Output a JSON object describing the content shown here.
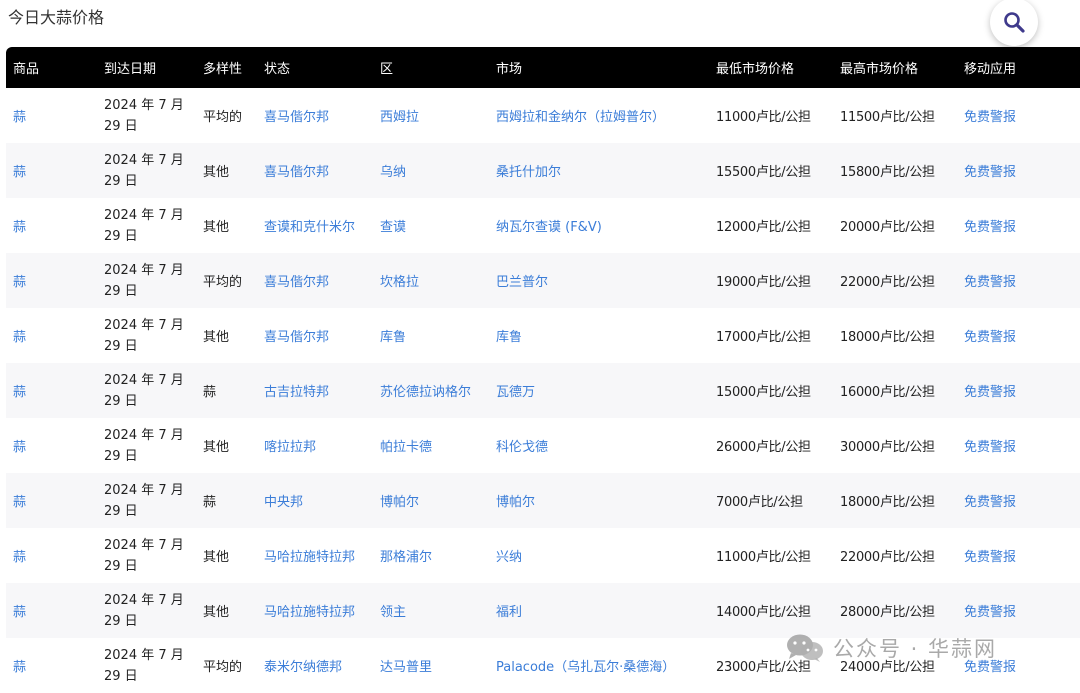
{
  "page": {
    "title": "今日大蒜价格"
  },
  "table": {
    "headers": [
      "商品",
      "到达日期",
      "多样性",
      "状态",
      "区",
      "市场",
      "最低市场价格",
      "最高市场价格",
      "移动应用"
    ],
    "rows": [
      {
        "commodity": "蒜",
        "date_line1": "2024 年 7 月",
        "date_line2": "29 日",
        "variety": "平均的",
        "state": "喜马偕尔邦",
        "district": "西姆拉",
        "market": "西姆拉和金纳尔（拉姆普尔）",
        "min_price": "11000卢比/公担",
        "max_price": "11500卢比/公担",
        "app": "免费警报"
      },
      {
        "commodity": "蒜",
        "date_line1": "2024 年 7 月",
        "date_line2": "29 日",
        "variety": "其他",
        "state": "喜马偕尔邦",
        "district": "乌纳",
        "market": "桑托什加尔",
        "min_price": "15500卢比/公担",
        "max_price": "15800卢比/公担",
        "app": "免费警报"
      },
      {
        "commodity": "蒜",
        "date_line1": "2024 年 7 月",
        "date_line2": "29 日",
        "variety": "其他",
        "state": "查谟和克什米尔",
        "district": "查谟",
        "market": "纳瓦尔查谟 (F&V)",
        "min_price": "12000卢比/公担",
        "max_price": "20000卢比/公担",
        "app": "免费警报"
      },
      {
        "commodity": "蒜",
        "date_line1": "2024 年 7 月",
        "date_line2": "29 日",
        "variety": "平均的",
        "state": "喜马偕尔邦",
        "district": "坎格拉",
        "market": "巴兰普尔",
        "min_price": "19000卢比/公担",
        "max_price": "22000卢比/公担",
        "app": "免费警报"
      },
      {
        "commodity": "蒜",
        "date_line1": "2024 年 7 月",
        "date_line2": "29 日",
        "variety": "其他",
        "state": "喜马偕尔邦",
        "district": "库鲁",
        "market": "库鲁",
        "min_price": "17000卢比/公担",
        "max_price": "18000卢比/公担",
        "app": "免费警报"
      },
      {
        "commodity": "蒜",
        "date_line1": "2024 年 7 月",
        "date_line2": "29 日",
        "variety": "蒜",
        "state": "古吉拉特邦",
        "district": "苏伦德拉讷格尔",
        "market": "瓦德万",
        "min_price": "15000卢比/公担",
        "max_price": "16000卢比/公担",
        "app": "免费警报"
      },
      {
        "commodity": "蒜",
        "date_line1": "2024 年 7 月",
        "date_line2": "29 日",
        "variety": "其他",
        "state": "喀拉拉邦",
        "district": "帕拉卡德",
        "market": "科伦戈德",
        "min_price": "26000卢比/公担",
        "max_price": "30000卢比/公担",
        "app": "免费警报"
      },
      {
        "commodity": "蒜",
        "date_line1": "2024 年 7 月",
        "date_line2": "29 日",
        "variety": "蒜",
        "state": "中央邦",
        "district": "博帕尔",
        "market": "博帕尔",
        "min_price": "7000卢比/公担",
        "max_price": "18000卢比/公担",
        "app": "免费警报"
      },
      {
        "commodity": "蒜",
        "date_line1": "2024 年 7 月",
        "date_line2": "29 日",
        "variety": "其他",
        "state": "马哈拉施特拉邦",
        "district": "那格浦尔",
        "market": "兴纳",
        "min_price": "11000卢比/公担",
        "max_price": "22000卢比/公担",
        "app": "免费警报"
      },
      {
        "commodity": "蒜",
        "date_line1": "2024 年 7 月",
        "date_line2": "29 日",
        "variety": "其他",
        "state": "马哈拉施特拉邦",
        "district": "领主",
        "market": "福利",
        "min_price": "14000卢比/公担",
        "max_price": "28000卢比/公担",
        "app": "免费警报"
      },
      {
        "commodity": "蒜",
        "date_line1": "2024 年 7 月",
        "date_line2": "29 日",
        "variety": "平均的",
        "state": "泰米尔纳德邦",
        "district": "达马普里",
        "market": "Palacode（乌扎瓦尔·桑德海）",
        "min_price": "23000卢比/公担",
        "max_price": "24000卢比/公担",
        "app": "免费警报"
      }
    ]
  },
  "watermark": {
    "text": "公众号 · 华蒜网"
  },
  "icons": {
    "search": "search-icon",
    "watermark": "wechat-icon"
  },
  "colors": {
    "link": "#3b7dd8",
    "header_bg": "#000000",
    "stripe": "#f7f7f9",
    "search_icon": "#3f3a8c"
  }
}
